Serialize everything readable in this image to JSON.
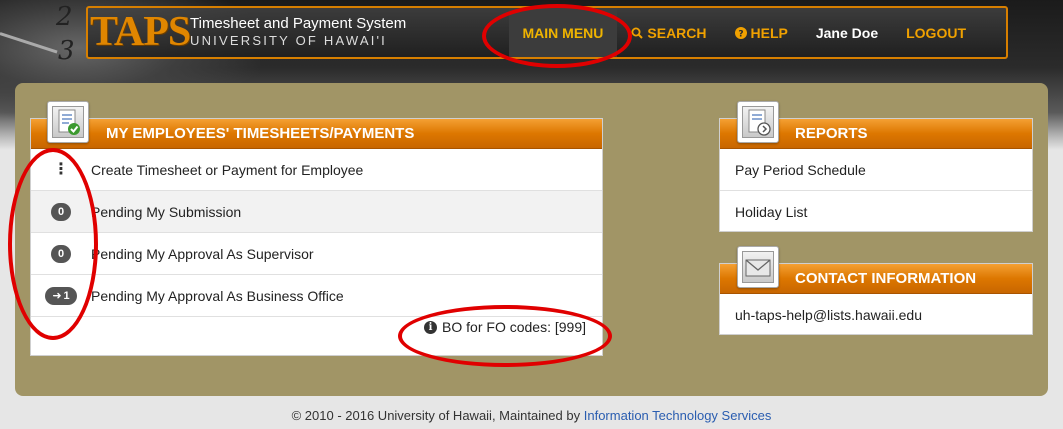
{
  "header": {
    "logo": "TAPS",
    "title": "Timesheet and Payment System",
    "subtitle": "UNIVERSITY OF HAWAI'I",
    "background_digits": [
      "2",
      "3"
    ],
    "nav": {
      "main_menu": "MAIN MENU",
      "search": "SEARCH",
      "help": "HELP",
      "user": "Jane Doe",
      "logout": "LOGOUT"
    }
  },
  "employees": {
    "title": "MY EMPLOYEES' TIMESHEETS/PAYMENTS",
    "rows": [
      {
        "badge": "",
        "label": "Create Timesheet or Payment for Employee"
      },
      {
        "badge": "0",
        "label": "Pending My Submission"
      },
      {
        "badge": "0",
        "label": "Pending My Approval As Supervisor"
      },
      {
        "badge": "1",
        "label": "Pending My Approval As Business Office"
      }
    ],
    "bo_codes": "BO for FO codes: [999]"
  },
  "reports": {
    "title": "REPORTS",
    "items": [
      "Pay Period Schedule",
      "Holiday List"
    ]
  },
  "contact": {
    "title": "CONTACT INFORMATION",
    "email": "uh-taps-help@lists.hawaii.edu"
  },
  "footer": {
    "text": "© 2010 - 2016 University of Hawaii, Maintained by",
    "link": "Information Technology Services"
  },
  "colors": {
    "accent_orange": "#dd7700",
    "panel_bg": "#a19566",
    "annotation_red": "#e00000"
  }
}
